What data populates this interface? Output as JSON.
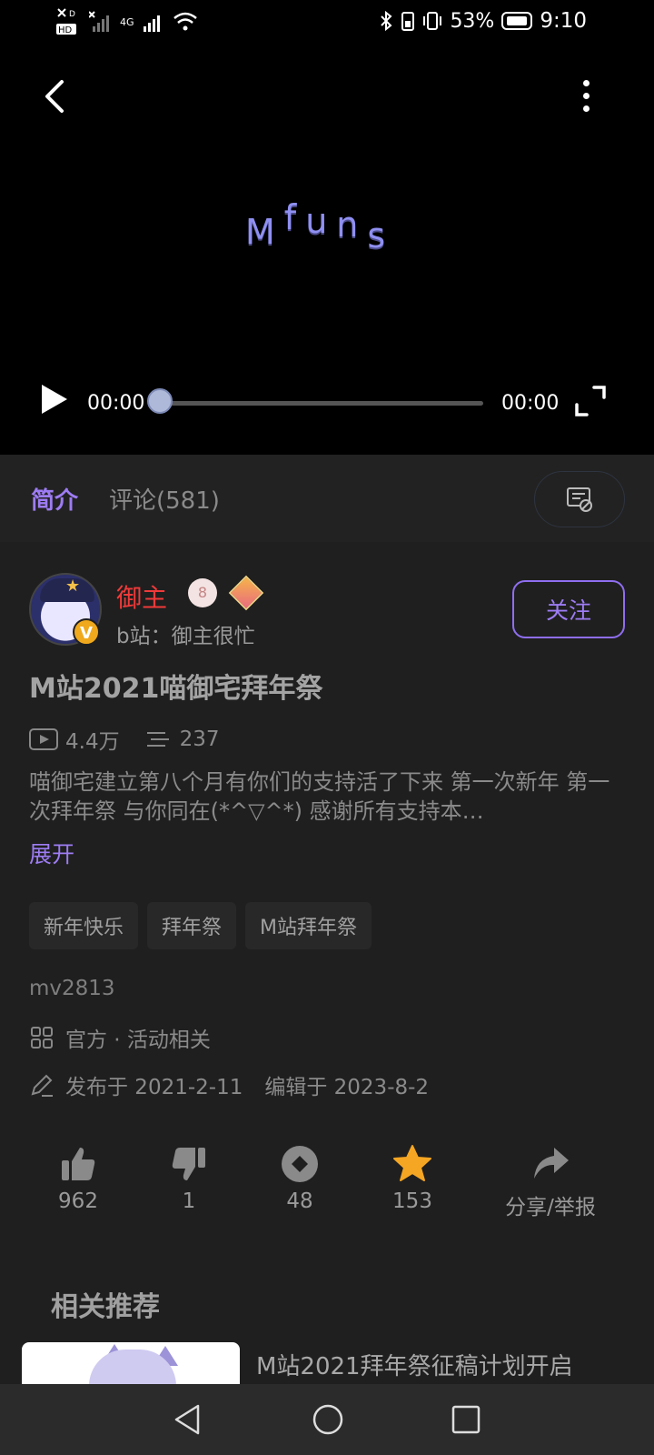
{
  "status_bar": {
    "left_tags": [
      "HD",
      "4G"
    ],
    "battery": "53%",
    "time": "9:10"
  },
  "player": {
    "logo": "Mfuns",
    "current_time": "00:00",
    "total_time": "00:00",
    "progress": 0
  },
  "tabs": {
    "intro": "简介",
    "comments": "评论(581)"
  },
  "author": {
    "name": "御主",
    "badge1_text": "8",
    "sub": "b站：御主很忙",
    "verified_letter": "V",
    "follow_label": "关注"
  },
  "video": {
    "title": "M站2021喵御宅拜年祭",
    "views": "4.4万",
    "danmaku": "237",
    "description": "喵御宅建立第八个月有你们的支持活了下来 第一次新年 第一次拜年祭 与你同在(*^▽^*) 感谢所有支持本…",
    "expand_label": "展开",
    "tags": [
      "新年快乐",
      "拜年祭",
      "M站拜年祭"
    ],
    "id": "mv2813",
    "category": "官方 · 活动相关",
    "published": "发布于 2021-2-11",
    "edited": "编辑于 2023-8-2"
  },
  "actions": {
    "like": "962",
    "dislike": "1",
    "coin": "48",
    "favorite": "153",
    "share": "分享/举报"
  },
  "colors": {
    "accent": "#9d7cf3",
    "author_name": "#f03a3a",
    "favorite": "#f5a623"
  },
  "related": {
    "heading": "相关推荐",
    "items": [
      {
        "title": "M站2021拜年祭征稿计划开启"
      }
    ]
  }
}
